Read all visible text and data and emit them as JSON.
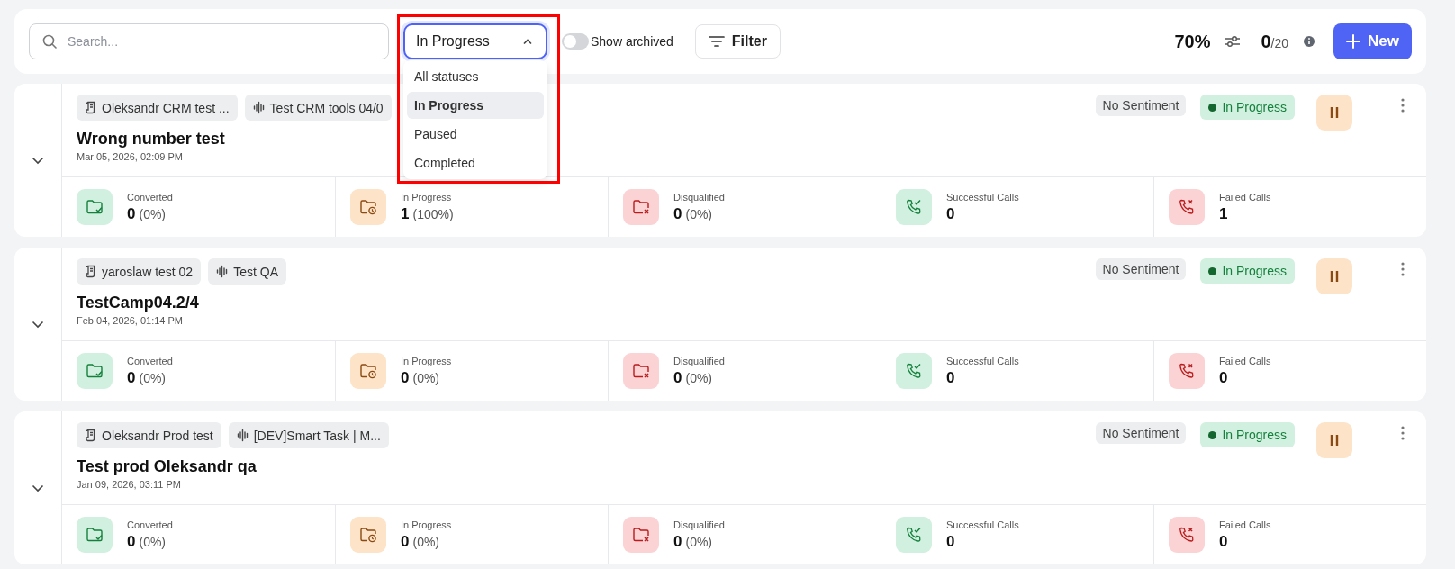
{
  "toolbar": {
    "search": {
      "placeholder": "Search..."
    },
    "status_filter": {
      "value": "In Progress",
      "expanded": true,
      "highlighted": true,
      "options": [
        {
          "label": "All statuses",
          "selected": false
        },
        {
          "label": "In Progress",
          "selected": true
        },
        {
          "label": "Paused",
          "selected": false
        },
        {
          "label": "Completed",
          "selected": false
        }
      ]
    },
    "show_archived": {
      "label": "Show archived",
      "on": false
    },
    "filter_button": "Filter",
    "success_rate": "70%",
    "usage": {
      "used": "0",
      "limit": "/20"
    },
    "new_button": "New"
  },
  "campaigns": [
    {
      "tags": [
        {
          "kind": "script",
          "label": "Oleksandr CRM test ..."
        },
        {
          "kind": "agent",
          "label": "Test CRM tools 04/0"
        }
      ],
      "title": "Wrong number test",
      "date": "Mar 05, 2026, 02:09 PM",
      "sentiment": "No Sentiment",
      "status": "In Progress",
      "running": true,
      "stats": [
        {
          "kind": "converted",
          "label": "Converted",
          "value": "0",
          "percent": "(0%)"
        },
        {
          "kind": "in_progress",
          "label": "In Progress",
          "value": "1",
          "percent": "(100%)"
        },
        {
          "kind": "disqualified",
          "label": "Disqualified",
          "value": "0",
          "percent": "(0%)"
        },
        {
          "kind": "successful_calls",
          "label": "Successful Calls",
          "value": "0"
        },
        {
          "kind": "failed_calls",
          "label": "Failed Calls",
          "value": "1"
        }
      ]
    },
    {
      "tags": [
        {
          "kind": "script",
          "label": "yaroslaw test 02"
        },
        {
          "kind": "agent",
          "label": "Test QA"
        }
      ],
      "title": "TestCamp04.2/4",
      "date": "Feb 04, 2026, 01:14 PM",
      "sentiment": "No Sentiment",
      "status": "In Progress",
      "running": true,
      "stats": [
        {
          "kind": "converted",
          "label": "Converted",
          "value": "0",
          "percent": "(0%)"
        },
        {
          "kind": "in_progress",
          "label": "In Progress",
          "value": "0",
          "percent": "(0%)"
        },
        {
          "kind": "disqualified",
          "label": "Disqualified",
          "value": "0",
          "percent": "(0%)"
        },
        {
          "kind": "successful_calls",
          "label": "Successful Calls",
          "value": "0"
        },
        {
          "kind": "failed_calls",
          "label": "Failed Calls",
          "value": "0"
        }
      ]
    },
    {
      "tags": [
        {
          "kind": "script",
          "label": "Oleksandr Prod test"
        },
        {
          "kind": "agent",
          "label": "[DEV]Smart Task | M..."
        }
      ],
      "title": "Test prod Oleksandr qa",
      "date": "Jan 09, 2026, 03:11 PM",
      "sentiment": "No Sentiment",
      "status": "In Progress",
      "running": true,
      "stats": [
        {
          "kind": "converted",
          "label": "Converted",
          "value": "0",
          "percent": "(0%)"
        },
        {
          "kind": "in_progress",
          "label": "In Progress",
          "value": "0",
          "percent": "(0%)"
        },
        {
          "kind": "disqualified",
          "label": "Disqualified",
          "value": "0",
          "percent": "(0%)"
        },
        {
          "kind": "successful_calls",
          "label": "Successful Calls",
          "value": "0"
        },
        {
          "kind": "failed_calls",
          "label": "Failed Calls",
          "value": "0"
        }
      ]
    }
  ]
}
